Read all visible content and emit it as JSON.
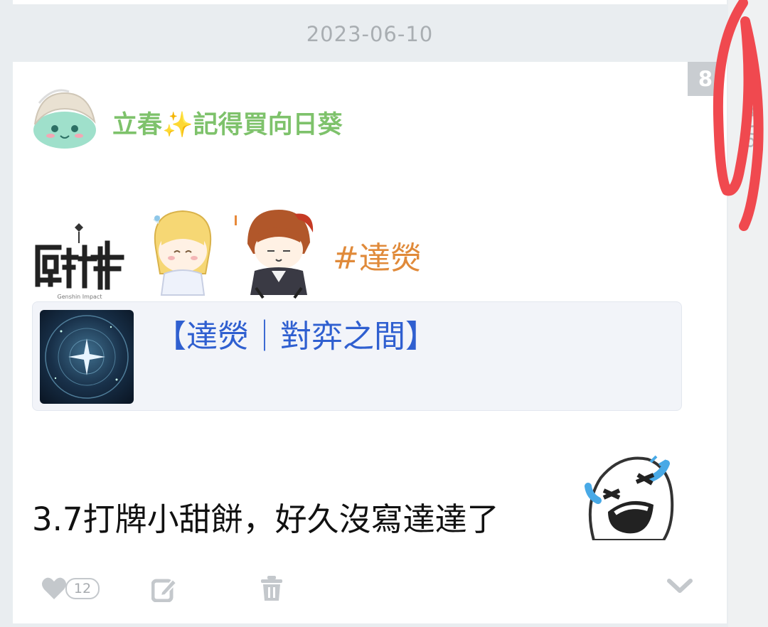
{
  "date_separator": "2023-06-10",
  "post": {
    "floor": "8",
    "time": "19:08",
    "author_name": "立春✨記得買向日葵",
    "hashtag": "#達熒",
    "link_card": {
      "title": "【達熒｜對弈之間】"
    },
    "body": "3.7打牌小甜餅，好久沒寫達達了",
    "actions": {
      "like_count": "12"
    }
  },
  "colors": {
    "author": "#7ec26b",
    "hashtag": "#e08a3a",
    "link": "#2f5fd0",
    "badge": "#c9cdd1",
    "annotation_stroke": "#f0494f"
  },
  "icons": [
    "heart-icon",
    "edit-icon",
    "trash-icon",
    "chevron-down-icon"
  ]
}
